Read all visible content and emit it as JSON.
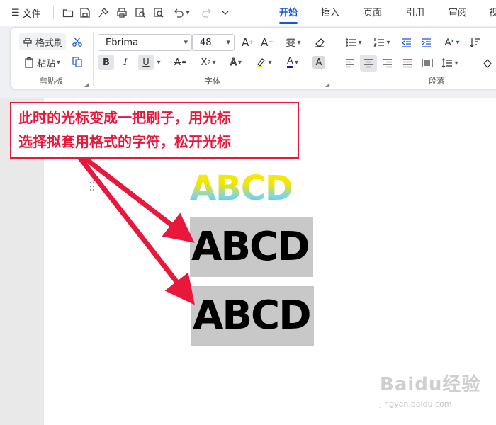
{
  "menubar": {
    "menu_icon": "menu-icon",
    "file_label": "文件",
    "quick_access": [
      "open-folder-icon",
      "save-icon",
      "format-painter-icon",
      "print-icon",
      "print-preview-icon",
      "find-icon",
      "undo-icon",
      "redo-icon",
      "more-icon"
    ],
    "tabs": [
      "开始",
      "插入",
      "页面",
      "引用",
      "审阅",
      "视"
    ],
    "active_tab": "开始",
    "accent_color": "#1a56d8"
  },
  "ribbon": {
    "clipboard": {
      "format_painter_label": "格式刷",
      "paste_label": "粘贴",
      "group_label": "剪贴板"
    },
    "font": {
      "font_name": "Ebrima",
      "font_size": "48",
      "bold": "B",
      "italic": "I",
      "underline": "U",
      "group_label": "字体",
      "font_color": "#1a1aa6"
    },
    "paragraph": {
      "group_label": "段落"
    }
  },
  "document": {
    "text_gradient": "ABCD",
    "text_selected_1": "ABCD",
    "text_selected_2": "ABCD",
    "selection_color": "#c8c8c8"
  },
  "annotation": {
    "line1": "此时的光标变成一把刷子，用光标",
    "line2": "选择拟套用格式的字符，松开光标",
    "color": "#e8173c"
  },
  "watermark": {
    "logo": "Baidu经验",
    "url": "jingyan.baidu.com"
  }
}
